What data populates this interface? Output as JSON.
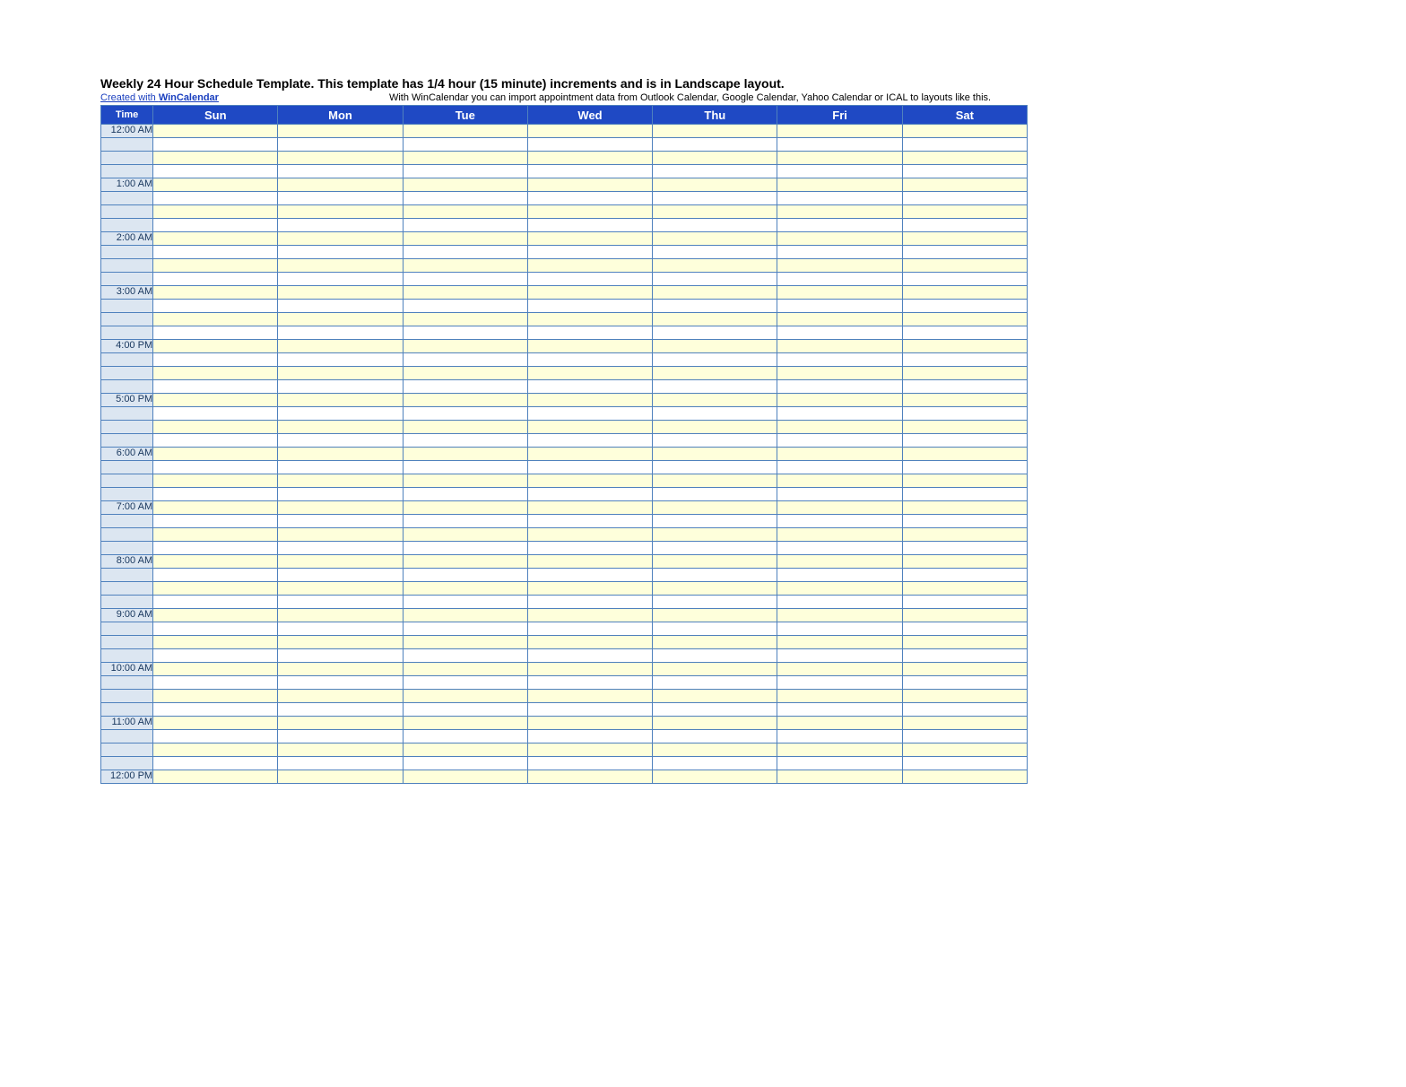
{
  "title": "Weekly 24 Hour Schedule Template.  This template has 1/4 hour (15 minute) increments and is in Landscape layout.",
  "credit_prefix": "Created with ",
  "credit_brand": "WinCalendar",
  "import_note": "With WinCalendar you can import appointment data from Outlook Calendar, Google Calendar, Yahoo Calendar or ICAL to layouts like this.",
  "header": {
    "time": "Time",
    "days": [
      "Sun",
      "Mon",
      "Tue",
      "Wed",
      "Thu",
      "Fri",
      "Sat"
    ]
  },
  "hours": [
    "12:00 AM",
    "1:00 AM",
    "2:00 AM",
    "3:00 AM",
    "4:00 PM",
    "5:00 PM",
    "6:00 AM",
    "7:00 AM",
    "8:00 AM",
    "9:00 AM",
    "10:00 AM",
    "11:00 AM",
    "12:00 PM"
  ],
  "quarters_per_hour": 4
}
